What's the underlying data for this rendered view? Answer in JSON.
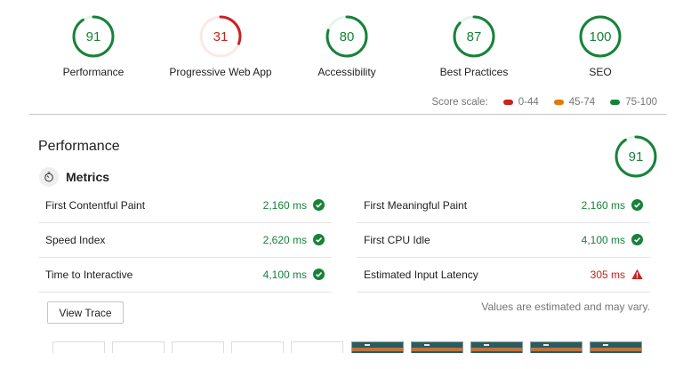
{
  "colors": {
    "pass": "#178239",
    "average": "#e67700",
    "fail": "#c7221f",
    "pass_light": "#e5f5e9",
    "fail_light": "#fbe9e8"
  },
  "categories": [
    {
      "label": "Performance",
      "score": 91,
      "rating": "pass"
    },
    {
      "label": "Progressive Web App",
      "score": 31,
      "rating": "fail"
    },
    {
      "label": "Accessibility",
      "score": 80,
      "rating": "pass"
    },
    {
      "label": "Best Practices",
      "score": 87,
      "rating": "pass"
    },
    {
      "label": "SEO",
      "score": 100,
      "rating": "pass"
    }
  ],
  "score_scale": {
    "label": "Score scale:",
    "ranges": [
      {
        "label": "0-44",
        "color": "#c7221f"
      },
      {
        "label": "45-74",
        "color": "#e67700"
      },
      {
        "label": "75-100",
        "color": "#178239"
      }
    ]
  },
  "performance": {
    "title": "Performance",
    "score": 91,
    "metrics_title": "Metrics",
    "metrics_icon": "stopwatch-icon",
    "left_metrics": [
      {
        "name": "First Contentful Paint",
        "value": "2,160 ms",
        "status": "pass",
        "icon": "check-circle-icon"
      },
      {
        "name": "Speed Index",
        "value": "2,620 ms",
        "status": "pass",
        "icon": "check-circle-icon"
      },
      {
        "name": "Time to Interactive",
        "value": "4,100 ms",
        "status": "pass",
        "icon": "check-circle-icon"
      }
    ],
    "right_metrics": [
      {
        "name": "First Meaningful Paint",
        "value": "2,160 ms",
        "status": "pass",
        "icon": "check-circle-icon"
      },
      {
        "name": "First CPU Idle",
        "value": "4,100 ms",
        "status": "pass",
        "icon": "check-circle-icon"
      },
      {
        "name": "Estimated Input Latency",
        "value": "305 ms",
        "status": "fail",
        "icon": "warning-triangle-icon"
      }
    ],
    "view_trace_label": "View Trace",
    "estimate_note": "Values are estimated and may vary.",
    "filmstrip": [
      {
        "state": "blank"
      },
      {
        "state": "blank"
      },
      {
        "state": "blank"
      },
      {
        "state": "blank"
      },
      {
        "state": "blank"
      },
      {
        "state": "loaded"
      },
      {
        "state": "loaded"
      },
      {
        "state": "loaded"
      },
      {
        "state": "loaded"
      },
      {
        "state": "loaded"
      }
    ]
  }
}
